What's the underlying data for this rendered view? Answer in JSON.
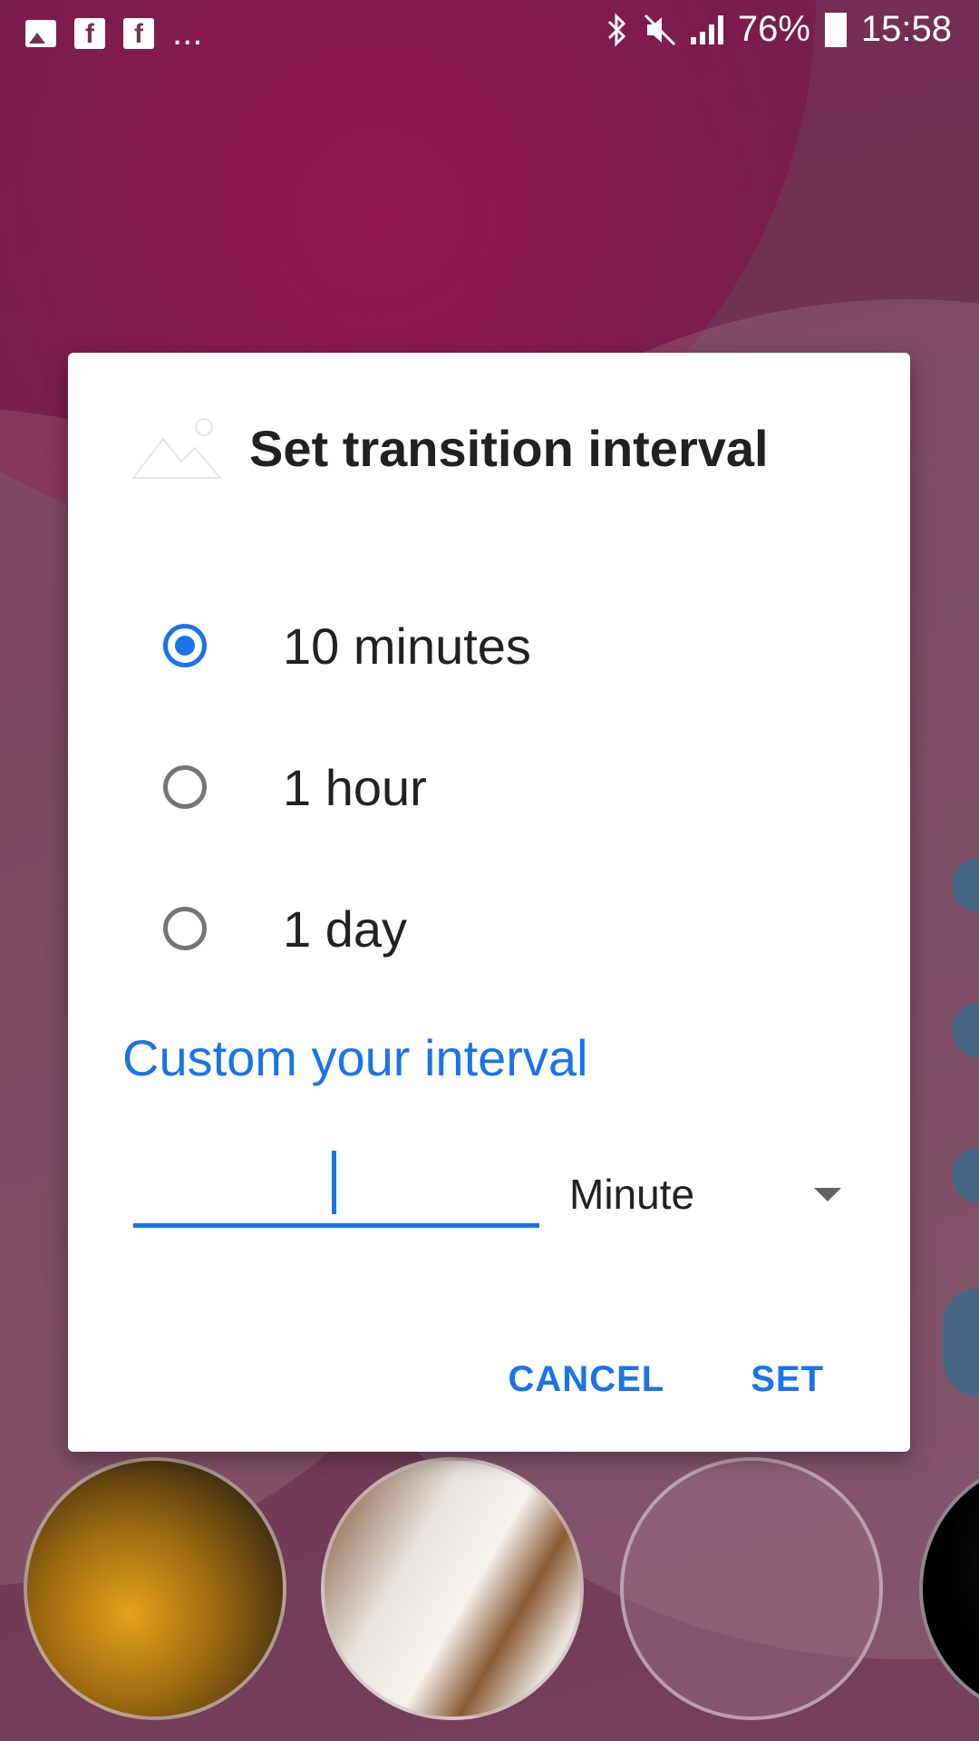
{
  "status_bar": {
    "more_notifications": "...",
    "battery_percent": "76%",
    "time": "15:58",
    "left_icons": [
      "gallery-icon",
      "facebook-icon",
      "facebook-icon"
    ],
    "right_icons": [
      "bluetooth-icon",
      "mute-icon",
      "signal-icon",
      "battery-charging-icon"
    ]
  },
  "dialog": {
    "title": "Set transition interval",
    "title_icon": "landscape-image-icon",
    "options": [
      {
        "label": "10 minutes",
        "selected": true
      },
      {
        "label": "1 hour",
        "selected": false
      },
      {
        "label": "1 day",
        "selected": false
      }
    ],
    "custom_title": "Custom your interval",
    "custom_value": "",
    "unit_selected": "Minute",
    "cancel_label": "CANCEL",
    "set_label": "SET"
  },
  "colors": {
    "accent": "#1a73e8",
    "dialog_bg": "#ffffff",
    "text": "#212121"
  }
}
